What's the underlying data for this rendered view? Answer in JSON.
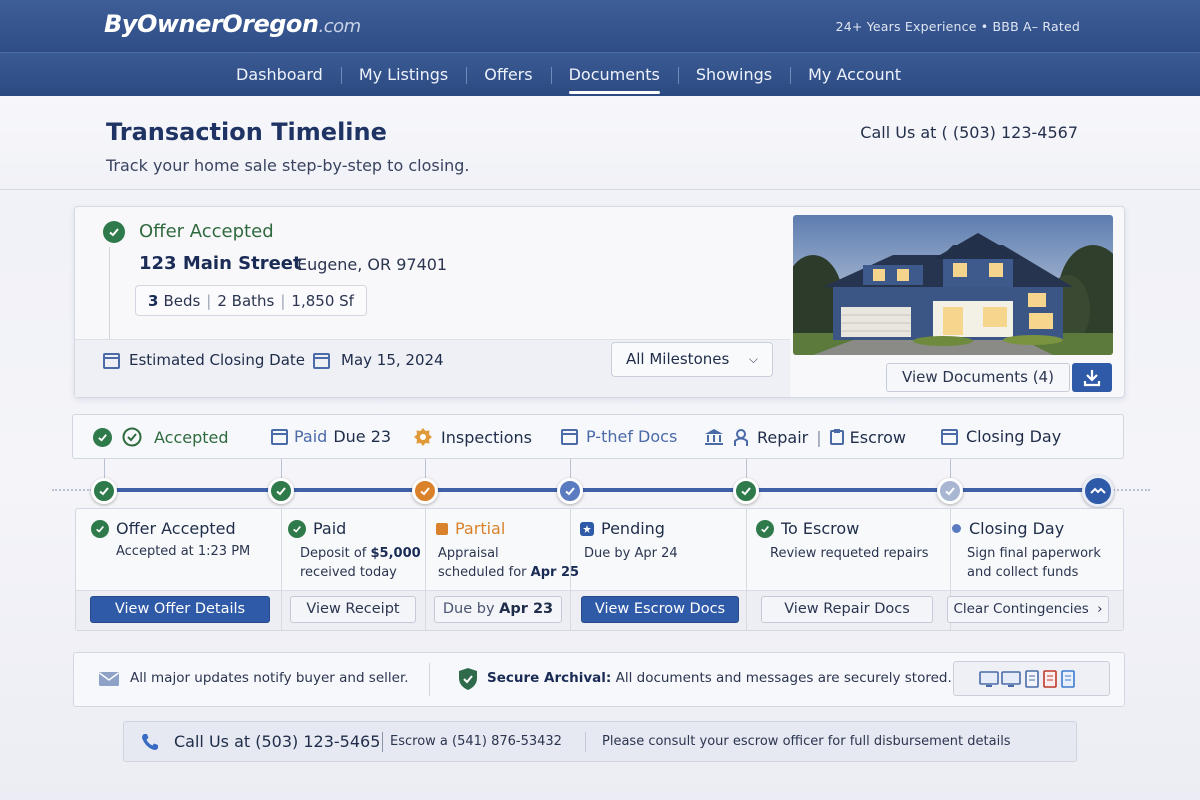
{
  "site": {
    "logo_main": "ByOwnerOregon",
    "logo_tld": ".com",
    "tagline": "24+ Years Experience • BBB A– Rated"
  },
  "nav": {
    "items": [
      "Dashboard",
      "My Listings",
      "Offers",
      "Documents",
      "Showings",
      "My Account"
    ],
    "active": "Documents"
  },
  "page": {
    "title": "Transaction Timeline",
    "subtitle": "Track your home sale step-by-step to closing.",
    "call_top": "Call Us at ( (503) 123-4567"
  },
  "summary": {
    "status": "Offer Accepted",
    "address": "123 Main Street",
    "city": "Eugene, OR 97401",
    "beds_num": "3",
    "beds_label": "Beds",
    "baths": "2 Baths",
    "sqft": "1,850 Sf",
    "closing_label": "Estimated Closing Date",
    "closing_date": "May 15, 2024",
    "milestones_select": "All Milestones",
    "view_documents": "View Documents (4)"
  },
  "milestone_strip": {
    "accepted": "Accepted",
    "paid": "Paid",
    "paid_due": "Due 23",
    "inspections": "Inspections",
    "docs": "P-thef Docs",
    "repair": "Repair",
    "escrow": "Escrow",
    "closing": "Closing Day"
  },
  "columns": [
    {
      "title": "Offer Accepted",
      "line1": "Accepted at 1:23 PM",
      "line2": "",
      "button": "View Offer Details"
    },
    {
      "title": "Paid",
      "line1_pre": "Deposit of ",
      "line1_bold": "$5,000",
      "line2": "received today",
      "button": "View Receipt"
    },
    {
      "title": "Partial",
      "line1": "Appraisal",
      "line2_pre": "scheduled for ",
      "line2_bold": "Apr 25",
      "button_pre": "Due by ",
      "button_bold": "Apr 23"
    },
    {
      "title": "Pending",
      "line1": "Due by Apr 24",
      "line2": "",
      "button": "View Escrow Docs"
    },
    {
      "title": "To Escrow",
      "line1": "Review requeted repairs",
      "line2": "",
      "button": "View Repair Docs"
    },
    {
      "title": "Closing Day",
      "line1": "Sign final paperwork",
      "line2": "and collect funds",
      "button": "Clear Contingencies"
    }
  ],
  "info": {
    "notify": "All major updates notify buyer and seller.",
    "secure_bold": "Secure Archival:",
    "secure_text": "All documents and messages are securely stored."
  },
  "footer": {
    "call": "Call Us at (503) 123-5465",
    "escrow": "Escrow a (541) 876-53432",
    "note": "Please consult your escrow officer for full disbursement details"
  },
  "icons": {
    "check": "check-icon",
    "calendar": "calendar-icon",
    "download": "download-icon",
    "envelope": "envelope-icon",
    "shield": "shield-icon",
    "phone": "phone-icon"
  },
  "colors": {
    "brand": "#2f4d86",
    "primary_button": "#2f5aa8",
    "success": "#2f7a4a",
    "warning": "#d9822b",
    "pending": "#5a7bc0"
  }
}
